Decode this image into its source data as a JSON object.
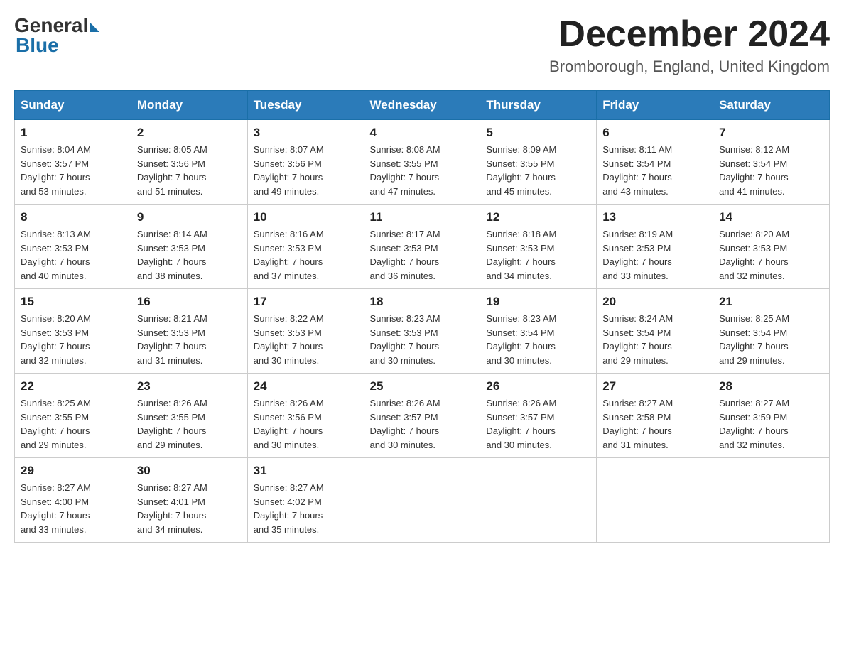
{
  "logo": {
    "general": "General",
    "blue": "Blue"
  },
  "title": {
    "month": "December 2024",
    "location": "Bromborough, England, United Kingdom"
  },
  "headers": [
    "Sunday",
    "Monday",
    "Tuesday",
    "Wednesday",
    "Thursday",
    "Friday",
    "Saturday"
  ],
  "weeks": [
    [
      {
        "day": "1",
        "info": "Sunrise: 8:04 AM\nSunset: 3:57 PM\nDaylight: 7 hours\nand 53 minutes."
      },
      {
        "day": "2",
        "info": "Sunrise: 8:05 AM\nSunset: 3:56 PM\nDaylight: 7 hours\nand 51 minutes."
      },
      {
        "day": "3",
        "info": "Sunrise: 8:07 AM\nSunset: 3:56 PM\nDaylight: 7 hours\nand 49 minutes."
      },
      {
        "day": "4",
        "info": "Sunrise: 8:08 AM\nSunset: 3:55 PM\nDaylight: 7 hours\nand 47 minutes."
      },
      {
        "day": "5",
        "info": "Sunrise: 8:09 AM\nSunset: 3:55 PM\nDaylight: 7 hours\nand 45 minutes."
      },
      {
        "day": "6",
        "info": "Sunrise: 8:11 AM\nSunset: 3:54 PM\nDaylight: 7 hours\nand 43 minutes."
      },
      {
        "day": "7",
        "info": "Sunrise: 8:12 AM\nSunset: 3:54 PM\nDaylight: 7 hours\nand 41 minutes."
      }
    ],
    [
      {
        "day": "8",
        "info": "Sunrise: 8:13 AM\nSunset: 3:53 PM\nDaylight: 7 hours\nand 40 minutes."
      },
      {
        "day": "9",
        "info": "Sunrise: 8:14 AM\nSunset: 3:53 PM\nDaylight: 7 hours\nand 38 minutes."
      },
      {
        "day": "10",
        "info": "Sunrise: 8:16 AM\nSunset: 3:53 PM\nDaylight: 7 hours\nand 37 minutes."
      },
      {
        "day": "11",
        "info": "Sunrise: 8:17 AM\nSunset: 3:53 PM\nDaylight: 7 hours\nand 36 minutes."
      },
      {
        "day": "12",
        "info": "Sunrise: 8:18 AM\nSunset: 3:53 PM\nDaylight: 7 hours\nand 34 minutes."
      },
      {
        "day": "13",
        "info": "Sunrise: 8:19 AM\nSunset: 3:53 PM\nDaylight: 7 hours\nand 33 minutes."
      },
      {
        "day": "14",
        "info": "Sunrise: 8:20 AM\nSunset: 3:53 PM\nDaylight: 7 hours\nand 32 minutes."
      }
    ],
    [
      {
        "day": "15",
        "info": "Sunrise: 8:20 AM\nSunset: 3:53 PM\nDaylight: 7 hours\nand 32 minutes."
      },
      {
        "day": "16",
        "info": "Sunrise: 8:21 AM\nSunset: 3:53 PM\nDaylight: 7 hours\nand 31 minutes."
      },
      {
        "day": "17",
        "info": "Sunrise: 8:22 AM\nSunset: 3:53 PM\nDaylight: 7 hours\nand 30 minutes."
      },
      {
        "day": "18",
        "info": "Sunrise: 8:23 AM\nSunset: 3:53 PM\nDaylight: 7 hours\nand 30 minutes."
      },
      {
        "day": "19",
        "info": "Sunrise: 8:23 AM\nSunset: 3:54 PM\nDaylight: 7 hours\nand 30 minutes."
      },
      {
        "day": "20",
        "info": "Sunrise: 8:24 AM\nSunset: 3:54 PM\nDaylight: 7 hours\nand 29 minutes."
      },
      {
        "day": "21",
        "info": "Sunrise: 8:25 AM\nSunset: 3:54 PM\nDaylight: 7 hours\nand 29 minutes."
      }
    ],
    [
      {
        "day": "22",
        "info": "Sunrise: 8:25 AM\nSunset: 3:55 PM\nDaylight: 7 hours\nand 29 minutes."
      },
      {
        "day": "23",
        "info": "Sunrise: 8:26 AM\nSunset: 3:55 PM\nDaylight: 7 hours\nand 29 minutes."
      },
      {
        "day": "24",
        "info": "Sunrise: 8:26 AM\nSunset: 3:56 PM\nDaylight: 7 hours\nand 30 minutes."
      },
      {
        "day": "25",
        "info": "Sunrise: 8:26 AM\nSunset: 3:57 PM\nDaylight: 7 hours\nand 30 minutes."
      },
      {
        "day": "26",
        "info": "Sunrise: 8:26 AM\nSunset: 3:57 PM\nDaylight: 7 hours\nand 30 minutes."
      },
      {
        "day": "27",
        "info": "Sunrise: 8:27 AM\nSunset: 3:58 PM\nDaylight: 7 hours\nand 31 minutes."
      },
      {
        "day": "28",
        "info": "Sunrise: 8:27 AM\nSunset: 3:59 PM\nDaylight: 7 hours\nand 32 minutes."
      }
    ],
    [
      {
        "day": "29",
        "info": "Sunrise: 8:27 AM\nSunset: 4:00 PM\nDaylight: 7 hours\nand 33 minutes."
      },
      {
        "day": "30",
        "info": "Sunrise: 8:27 AM\nSunset: 4:01 PM\nDaylight: 7 hours\nand 34 minutes."
      },
      {
        "day": "31",
        "info": "Sunrise: 8:27 AM\nSunset: 4:02 PM\nDaylight: 7 hours\nand 35 minutes."
      },
      {
        "day": "",
        "info": ""
      },
      {
        "day": "",
        "info": ""
      },
      {
        "day": "",
        "info": ""
      },
      {
        "day": "",
        "info": ""
      }
    ]
  ]
}
